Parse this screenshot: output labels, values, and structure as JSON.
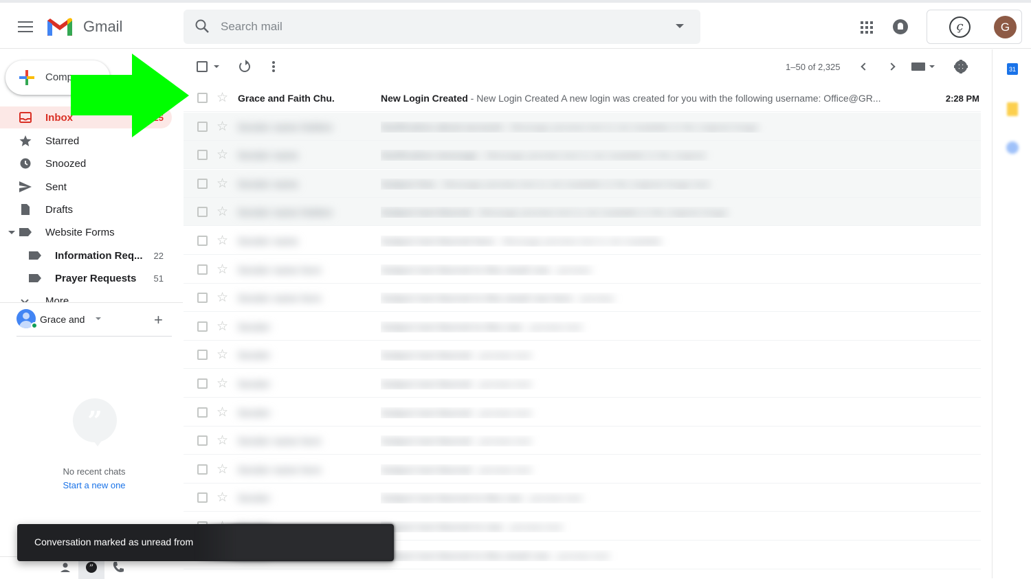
{
  "header": {
    "brand": "Gmail",
    "search_placeholder": "Search mail",
    "account_initial": "G",
    "colors": {
      "gmail_red": "#d93025",
      "accent_blue": "#1a73e8"
    }
  },
  "sidebar": {
    "compose_label": "Compose",
    "items": [
      {
        "label": "Inbox",
        "count": "2,325",
        "icon": "inbox-icon",
        "active": true
      },
      {
        "label": "Starred",
        "count": "",
        "icon": "star-icon"
      },
      {
        "label": "Snoozed",
        "count": "",
        "icon": "clock-icon"
      },
      {
        "label": "Sent",
        "count": "",
        "icon": "send-icon"
      },
      {
        "label": "Drafts",
        "count": "",
        "icon": "draft-icon"
      },
      {
        "label": "Website Forms",
        "count": "",
        "icon": "label-icon"
      },
      {
        "label": "Information Req...",
        "count": "22",
        "icon": "label-icon"
      },
      {
        "label": "Prayer Requests",
        "count": "51",
        "icon": "label-icon"
      }
    ],
    "more_label": "More",
    "hangouts": {
      "user_name": "Grace and",
      "no_chats": "No recent chats",
      "start_new": "Start a new one"
    }
  },
  "toolbar": {
    "pagination": "1–50 of 2,325"
  },
  "emails": [
    {
      "sender": "Grace and Faith Chu.",
      "subject": "New Login Created",
      "snippet": " - New Login Created A new login was created for you with the following username: Office@GR...",
      "time": "2:28 PM",
      "blurred": false
    },
    {
      "sender": "Sender name hidden",
      "subject": "Notification about account",
      "snippet": " - Message preview text is not readable in the original image",
      "time": "",
      "blurred": true,
      "shaded": true
    },
    {
      "sender": "Sender name",
      "subject": "Notification message",
      "snippet": " - Message preview text is not readable in the original",
      "time": "",
      "blurred": true,
      "shaded": true
    },
    {
      "sender": "Sender name",
      "subject": "Subject line",
      "snippet": " - Message preview text is not readable in the original image text",
      "time": "",
      "blurred": true,
      "shaded": true
    },
    {
      "sender": "Sender name hidden",
      "subject": "Subject text blurred",
      "snippet": " - Message preview text is not readable in the original image",
      "time": "",
      "blurred": true,
      "shaded": true
    },
    {
      "sender": "Sender name",
      "subject": "Subject text blurred here",
      "snippet": " - Message preview text is not readable",
      "time": "",
      "blurred": true
    },
    {
      "sender": "Sender name here",
      "subject": "Subject text blurred in this email row",
      "snippet": " - preview",
      "time": "",
      "blurred": true
    },
    {
      "sender": "Sender name here",
      "subject": "Subject text blurred in this email row here",
      "snippet": " - preview",
      "time": "",
      "blurred": true
    },
    {
      "sender": "Sender",
      "subject": "Subject text blurred in this row",
      "snippet": " - preview text",
      "time": "",
      "blurred": true
    },
    {
      "sender": "Sender",
      "subject": "Subject text blurred",
      "snippet": " - preview text",
      "time": "",
      "blurred": true
    },
    {
      "sender": "Sender",
      "subject": "Subject text blurred",
      "snippet": " - preview text",
      "time": "",
      "blurred": true
    },
    {
      "sender": "Sender",
      "subject": "Subject text blurred",
      "snippet": " - preview text",
      "time": "",
      "blurred": true
    },
    {
      "sender": "Sender name here",
      "subject": "Subject text blurred",
      "snippet": " - preview text",
      "time": "",
      "blurred": true
    },
    {
      "sender": "Sender name here",
      "subject": "Subject text blurred",
      "snippet": " - preview text",
      "time": "",
      "blurred": true
    },
    {
      "sender": "Sender",
      "subject": "Subject text blurred in this row",
      "snippet": " - preview text",
      "time": "",
      "blurred": true
    },
    {
      "sender": "Sender",
      "subject": "Subject text blurred in row",
      "snippet": " - preview text",
      "time": "",
      "blurred": true
    },
    {
      "sender": "Sender",
      "subject": "Subject text blurred in this email row",
      "snippet": " - preview text",
      "time": "",
      "blurred": true
    }
  ],
  "toast": {
    "message": "Conversation marked as unread from"
  },
  "side_panel": {
    "calendar_day": "31"
  },
  "annotation": {
    "arrow_color": "#00ff00"
  }
}
